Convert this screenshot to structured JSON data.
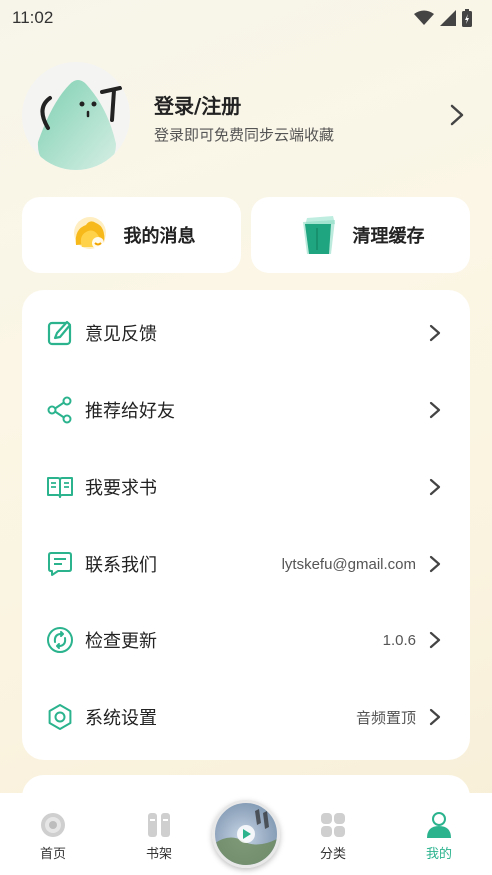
{
  "status_bar": {
    "time": "11:02"
  },
  "profile": {
    "title": "登录/注册",
    "subtitle": "登录即可免费同步云端收藏"
  },
  "quick_actions": [
    {
      "label": "我的消息",
      "icon": "bell-icon"
    },
    {
      "label": "清理缓存",
      "icon": "trash-icon"
    }
  ],
  "menu": [
    {
      "label": "意见反馈",
      "value": "",
      "icon": "edit-icon"
    },
    {
      "label": "推荐给好友",
      "value": "",
      "icon": "share-icon"
    },
    {
      "label": "我要求书",
      "value": "",
      "icon": "book-icon"
    },
    {
      "label": "联系我们",
      "value": "lytskefu@gmail.com",
      "icon": "message-icon"
    },
    {
      "label": "检查更新",
      "value": "1.0.6",
      "icon": "refresh-icon"
    },
    {
      "label": "系统设置",
      "value": "音频置顶",
      "icon": "settings-icon"
    }
  ],
  "tabs": [
    {
      "label": "首页",
      "icon": "disc-icon"
    },
    {
      "label": "书架",
      "icon": "bookshelf-icon"
    },
    {
      "label": "分类",
      "icon": "category-icon"
    },
    {
      "label": "我的",
      "icon": "user-icon"
    }
  ],
  "colors": {
    "accent": "#2bb38e",
    "background": "#faf4e2"
  }
}
